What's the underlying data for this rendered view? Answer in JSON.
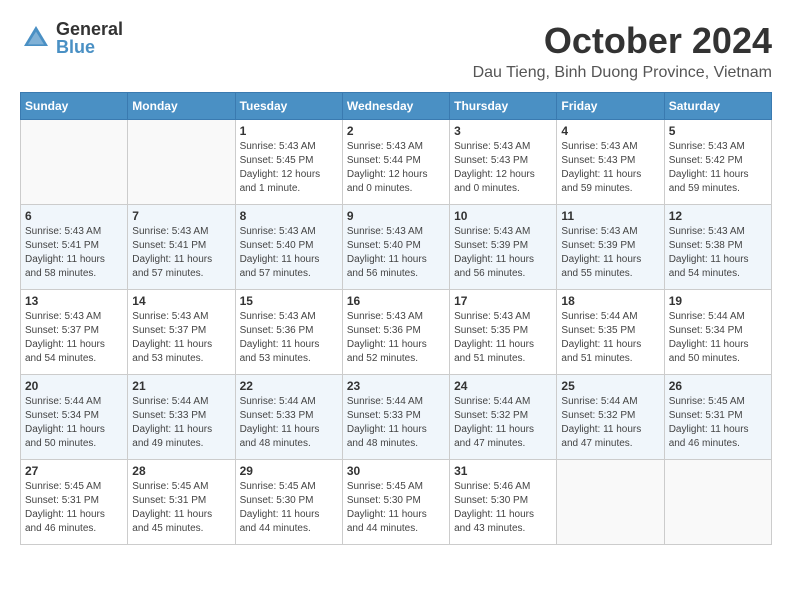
{
  "logo": {
    "general": "General",
    "blue": "Blue"
  },
  "title": {
    "month": "October 2024",
    "location": "Dau Tieng, Binh Duong Province, Vietnam"
  },
  "headers": [
    "Sunday",
    "Monday",
    "Tuesday",
    "Wednesday",
    "Thursday",
    "Friday",
    "Saturday"
  ],
  "weeks": [
    [
      {
        "day": "",
        "info": ""
      },
      {
        "day": "",
        "info": ""
      },
      {
        "day": "1",
        "info": "Sunrise: 5:43 AM\nSunset: 5:45 PM\nDaylight: 12 hours and 1 minute."
      },
      {
        "day": "2",
        "info": "Sunrise: 5:43 AM\nSunset: 5:44 PM\nDaylight: 12 hours and 0 minutes."
      },
      {
        "day": "3",
        "info": "Sunrise: 5:43 AM\nSunset: 5:43 PM\nDaylight: 12 hours and 0 minutes."
      },
      {
        "day": "4",
        "info": "Sunrise: 5:43 AM\nSunset: 5:43 PM\nDaylight: 11 hours and 59 minutes."
      },
      {
        "day": "5",
        "info": "Sunrise: 5:43 AM\nSunset: 5:42 PM\nDaylight: 11 hours and 59 minutes."
      }
    ],
    [
      {
        "day": "6",
        "info": "Sunrise: 5:43 AM\nSunset: 5:41 PM\nDaylight: 11 hours and 58 minutes."
      },
      {
        "day": "7",
        "info": "Sunrise: 5:43 AM\nSunset: 5:41 PM\nDaylight: 11 hours and 57 minutes."
      },
      {
        "day": "8",
        "info": "Sunrise: 5:43 AM\nSunset: 5:40 PM\nDaylight: 11 hours and 57 minutes."
      },
      {
        "day": "9",
        "info": "Sunrise: 5:43 AM\nSunset: 5:40 PM\nDaylight: 11 hours and 56 minutes."
      },
      {
        "day": "10",
        "info": "Sunrise: 5:43 AM\nSunset: 5:39 PM\nDaylight: 11 hours and 56 minutes."
      },
      {
        "day": "11",
        "info": "Sunrise: 5:43 AM\nSunset: 5:39 PM\nDaylight: 11 hours and 55 minutes."
      },
      {
        "day": "12",
        "info": "Sunrise: 5:43 AM\nSunset: 5:38 PM\nDaylight: 11 hours and 54 minutes."
      }
    ],
    [
      {
        "day": "13",
        "info": "Sunrise: 5:43 AM\nSunset: 5:37 PM\nDaylight: 11 hours and 54 minutes."
      },
      {
        "day": "14",
        "info": "Sunrise: 5:43 AM\nSunset: 5:37 PM\nDaylight: 11 hours and 53 minutes."
      },
      {
        "day": "15",
        "info": "Sunrise: 5:43 AM\nSunset: 5:36 PM\nDaylight: 11 hours and 53 minutes."
      },
      {
        "day": "16",
        "info": "Sunrise: 5:43 AM\nSunset: 5:36 PM\nDaylight: 11 hours and 52 minutes."
      },
      {
        "day": "17",
        "info": "Sunrise: 5:43 AM\nSunset: 5:35 PM\nDaylight: 11 hours and 51 minutes."
      },
      {
        "day": "18",
        "info": "Sunrise: 5:44 AM\nSunset: 5:35 PM\nDaylight: 11 hours and 51 minutes."
      },
      {
        "day": "19",
        "info": "Sunrise: 5:44 AM\nSunset: 5:34 PM\nDaylight: 11 hours and 50 minutes."
      }
    ],
    [
      {
        "day": "20",
        "info": "Sunrise: 5:44 AM\nSunset: 5:34 PM\nDaylight: 11 hours and 50 minutes."
      },
      {
        "day": "21",
        "info": "Sunrise: 5:44 AM\nSunset: 5:33 PM\nDaylight: 11 hours and 49 minutes."
      },
      {
        "day": "22",
        "info": "Sunrise: 5:44 AM\nSunset: 5:33 PM\nDaylight: 11 hours and 48 minutes."
      },
      {
        "day": "23",
        "info": "Sunrise: 5:44 AM\nSunset: 5:33 PM\nDaylight: 11 hours and 48 minutes."
      },
      {
        "day": "24",
        "info": "Sunrise: 5:44 AM\nSunset: 5:32 PM\nDaylight: 11 hours and 47 minutes."
      },
      {
        "day": "25",
        "info": "Sunrise: 5:44 AM\nSunset: 5:32 PM\nDaylight: 11 hours and 47 minutes."
      },
      {
        "day": "26",
        "info": "Sunrise: 5:45 AM\nSunset: 5:31 PM\nDaylight: 11 hours and 46 minutes."
      }
    ],
    [
      {
        "day": "27",
        "info": "Sunrise: 5:45 AM\nSunset: 5:31 PM\nDaylight: 11 hours and 46 minutes."
      },
      {
        "day": "28",
        "info": "Sunrise: 5:45 AM\nSunset: 5:31 PM\nDaylight: 11 hours and 45 minutes."
      },
      {
        "day": "29",
        "info": "Sunrise: 5:45 AM\nSunset: 5:30 PM\nDaylight: 11 hours and 44 minutes."
      },
      {
        "day": "30",
        "info": "Sunrise: 5:45 AM\nSunset: 5:30 PM\nDaylight: 11 hours and 44 minutes."
      },
      {
        "day": "31",
        "info": "Sunrise: 5:46 AM\nSunset: 5:30 PM\nDaylight: 11 hours and 43 minutes."
      },
      {
        "day": "",
        "info": ""
      },
      {
        "day": "",
        "info": ""
      }
    ]
  ]
}
